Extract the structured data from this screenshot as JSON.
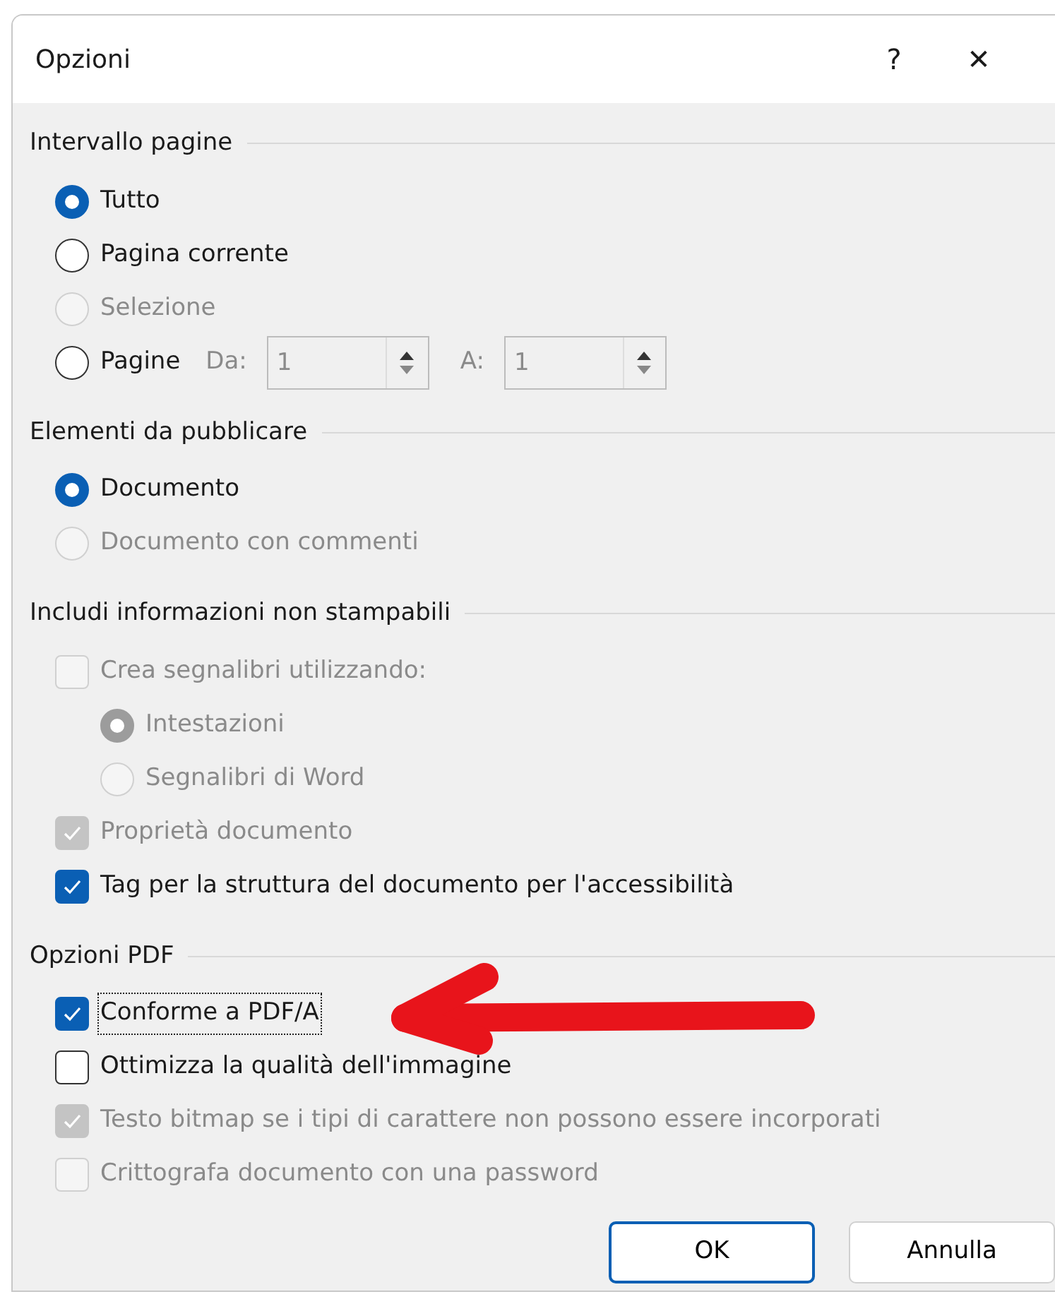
{
  "window": {
    "title": "Opzioni",
    "help": "?",
    "close": "✕"
  },
  "sections": [
    {
      "title": "Intervallo pagine",
      "items": [
        {
          "kind": "radio",
          "label": "Tutto",
          "selected": true,
          "disabled": false
        },
        {
          "kind": "radio",
          "label": "Pagina corrente",
          "selected": false,
          "disabled": false
        },
        {
          "kind": "radio",
          "label": "Selezione",
          "selected": false,
          "disabled": true
        },
        {
          "kind": "pages",
          "label": "Pagine",
          "selected": false,
          "disabled": false,
          "from_label": "Da:",
          "from_value": "1",
          "to_label": "A:",
          "to_value": "1"
        }
      ]
    },
    {
      "title": "Elementi da pubblicare",
      "items": [
        {
          "kind": "radio",
          "label": "Documento",
          "selected": true,
          "disabled": false
        },
        {
          "kind": "radio",
          "label": "Documento con commenti",
          "selected": false,
          "disabled": true
        }
      ]
    },
    {
      "title": "Includi informazioni non stampabili",
      "items": [
        {
          "kind": "checkbox",
          "label": "Crea segnalibri utilizzando:",
          "checked": false,
          "disabled": true,
          "children": [
            {
              "kind": "radio",
              "label": "Intestazioni",
              "selected": true,
              "disabled": true
            },
            {
              "kind": "radio",
              "label": "Segnalibri di Word",
              "selected": false,
              "disabled": true
            }
          ]
        },
        {
          "kind": "checkbox",
          "label": "Proprietà documento",
          "checked": true,
          "disabled": true
        },
        {
          "kind": "checkbox",
          "label": "Tag per la struttura del documento per l'accessibilità",
          "checked": true,
          "disabled": false
        }
      ]
    },
    {
      "title": "Opzioni PDF",
      "items": [
        {
          "kind": "checkbox",
          "label": "Conforme a PDF/A",
          "checked": true,
          "disabled": false,
          "focused": true
        },
        {
          "kind": "checkbox",
          "label": "Ottimizza la qualità dell'immagine",
          "checked": false,
          "disabled": false
        },
        {
          "kind": "checkbox",
          "label": "Testo bitmap se i tipi di carattere non possono essere incorporati",
          "checked": true,
          "disabled": true
        },
        {
          "kind": "checkbox",
          "label": "Crittografa documento con una password",
          "checked": false,
          "disabled": true
        }
      ]
    }
  ],
  "buttons": [
    {
      "label": "OK",
      "default": true
    },
    {
      "label": "Annulla",
      "default": false
    }
  ]
}
